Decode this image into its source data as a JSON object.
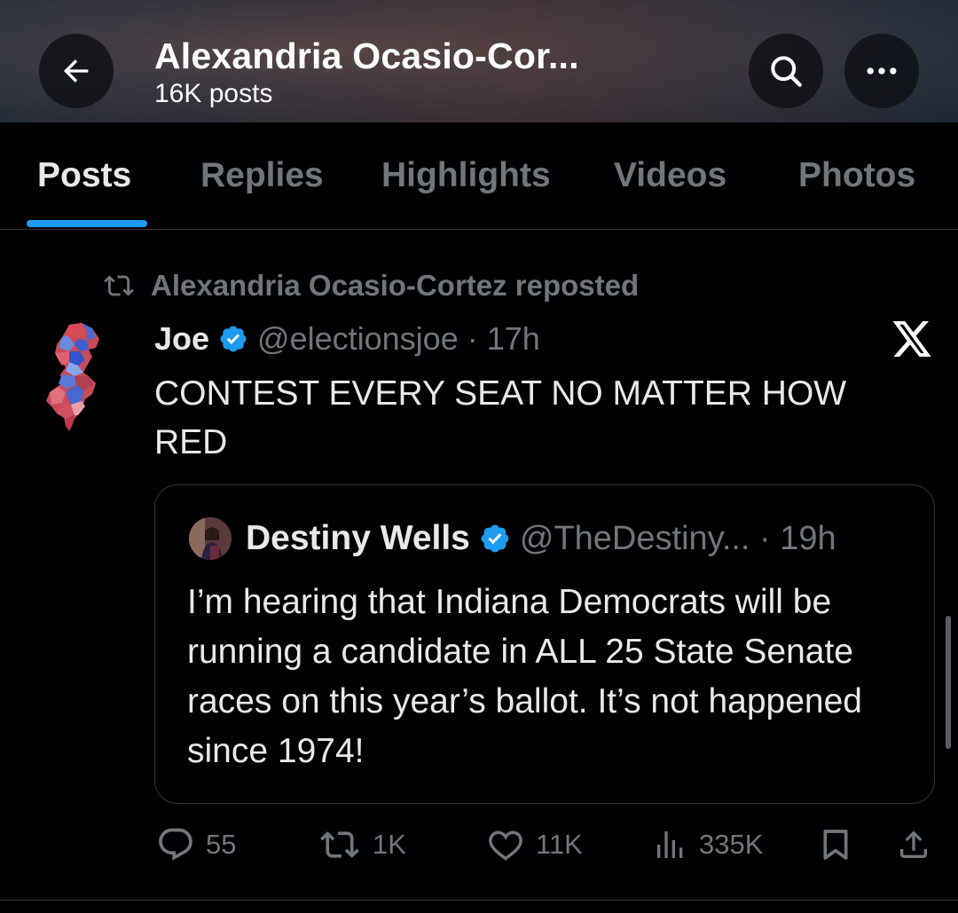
{
  "header": {
    "title": "Alexandria Ocasio-Cor...",
    "subtitle": "16K posts",
    "back_icon": "arrow-left-icon",
    "search_icon": "search-icon",
    "more_icon": "more-horizontal-icon"
  },
  "tabs": [
    {
      "label": "Posts",
      "active": true
    },
    {
      "label": "Replies",
      "active": false
    },
    {
      "label": "Highlights",
      "active": false
    },
    {
      "label": "Videos",
      "active": false
    },
    {
      "label": "Photos",
      "active": false
    }
  ],
  "post": {
    "repost_text": "Alexandria Ocasio-Cortez reposted",
    "author_name": "Joe",
    "handle_time": "@electionsjoe · 17h",
    "text": "CONTEST EVERY SEAT NO MATTER HOW RED",
    "quote": {
      "author_name": "Destiny Wells",
      "handle_time": "@TheDestiny... · 19h",
      "text": "I’m hearing that Indiana Democrats will be running a candidate in ALL 25 State Senate races on this year’s ballot. It’s not happened since 1974!"
    },
    "actions": {
      "replies": "55",
      "reposts": "1K",
      "likes": "11K",
      "views": "335K"
    }
  },
  "colors": {
    "accent": "#1d9bf0",
    "muted": "#71767b",
    "text": "#e7e9ea",
    "background": "#000000"
  }
}
